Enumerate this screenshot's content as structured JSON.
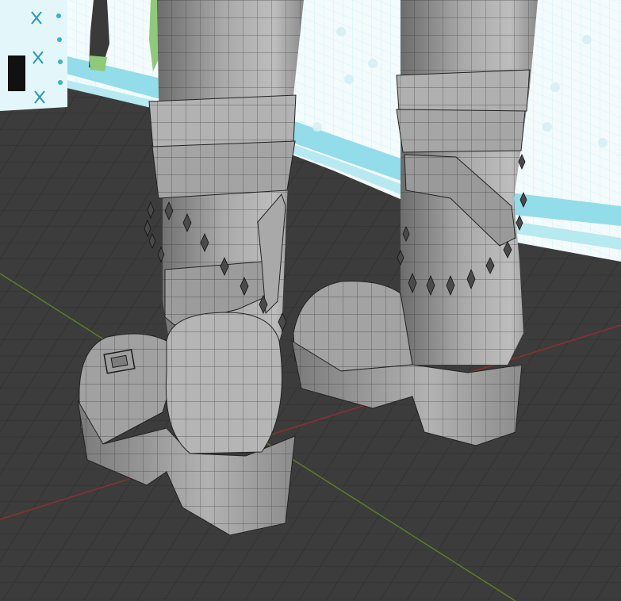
{
  "viewport": {
    "colors": {
      "floor": "#3c3c3c",
      "grid_line": "#2c2c2c",
      "x_axis": "#8a2f35",
      "y_axis": "#5b7c2c",
      "backdrop_white": "#f4fbfd",
      "backdrop_cyan": "#8fdbe8",
      "backdrop_grid": "#c9eef4",
      "mesh_fill": "#8e8e8e",
      "mesh_light": "#b4b4b4",
      "mesh_dark": "#5e5e5e",
      "wire": "#1c1c1c"
    },
    "objects": {
      "left_boot": "left-boot-mesh",
      "right_boot": "right-boot-mesh",
      "backdrop": "background-reference-image"
    }
  }
}
